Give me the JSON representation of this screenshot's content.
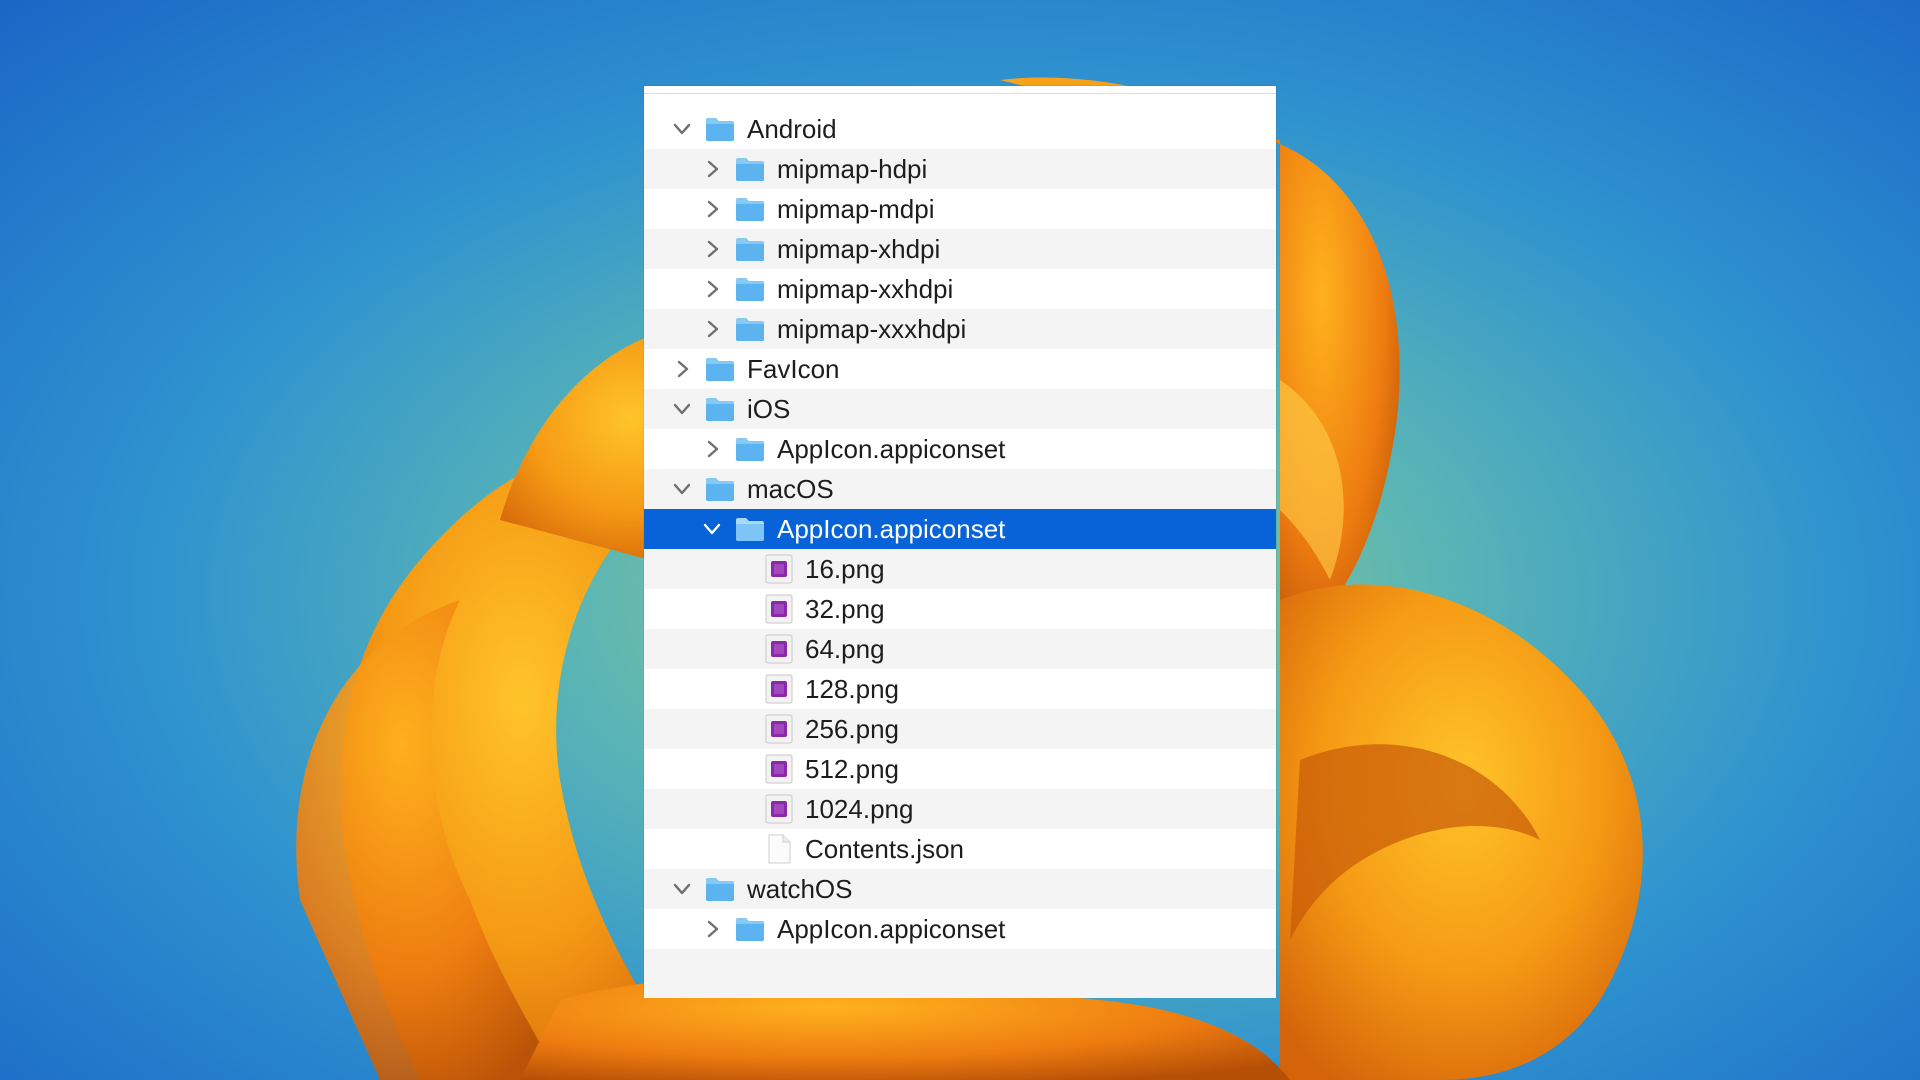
{
  "tree": {
    "rows": [
      {
        "label": "Android",
        "kind": "folder",
        "expanded": true
      },
      {
        "label": "mipmap-hdpi",
        "kind": "folder",
        "expanded": false
      },
      {
        "label": "mipmap-mdpi",
        "kind": "folder",
        "expanded": false
      },
      {
        "label": "mipmap-xhdpi",
        "kind": "folder",
        "expanded": false
      },
      {
        "label": "mipmap-xxhdpi",
        "kind": "folder",
        "expanded": false
      },
      {
        "label": "mipmap-xxxhdpi",
        "kind": "folder",
        "expanded": false
      },
      {
        "label": "FavIcon",
        "kind": "folder",
        "expanded": false
      },
      {
        "label": "iOS",
        "kind": "folder",
        "expanded": true
      },
      {
        "label": "AppIcon.appiconset",
        "kind": "folder",
        "expanded": false
      },
      {
        "label": "macOS",
        "kind": "folder",
        "expanded": true
      },
      {
        "label": "AppIcon.appiconset",
        "kind": "folder",
        "expanded": true,
        "selected": true
      },
      {
        "label": "16.png",
        "kind": "png"
      },
      {
        "label": "32.png",
        "kind": "png"
      },
      {
        "label": "64.png",
        "kind": "png"
      },
      {
        "label": "128.png",
        "kind": "png"
      },
      {
        "label": "256.png",
        "kind": "png"
      },
      {
        "label": "512.png",
        "kind": "png"
      },
      {
        "label": "1024.png",
        "kind": "png"
      },
      {
        "label": "Contents.json",
        "kind": "json"
      },
      {
        "label": "watchOS",
        "kind": "folder",
        "expanded": true
      },
      {
        "label": "AppIcon.appiconset",
        "kind": "folder",
        "expanded": false
      }
    ]
  },
  "colors": {
    "selection": "#0862d8",
    "folder": "#5bb4f0",
    "png_accent": "#8a2aa8"
  },
  "icons": {
    "expanded": "chevron-down-icon",
    "collapsed": "chevron-right-icon",
    "folder": "folder-icon",
    "png": "png-file-icon",
    "json": "document-icon"
  }
}
